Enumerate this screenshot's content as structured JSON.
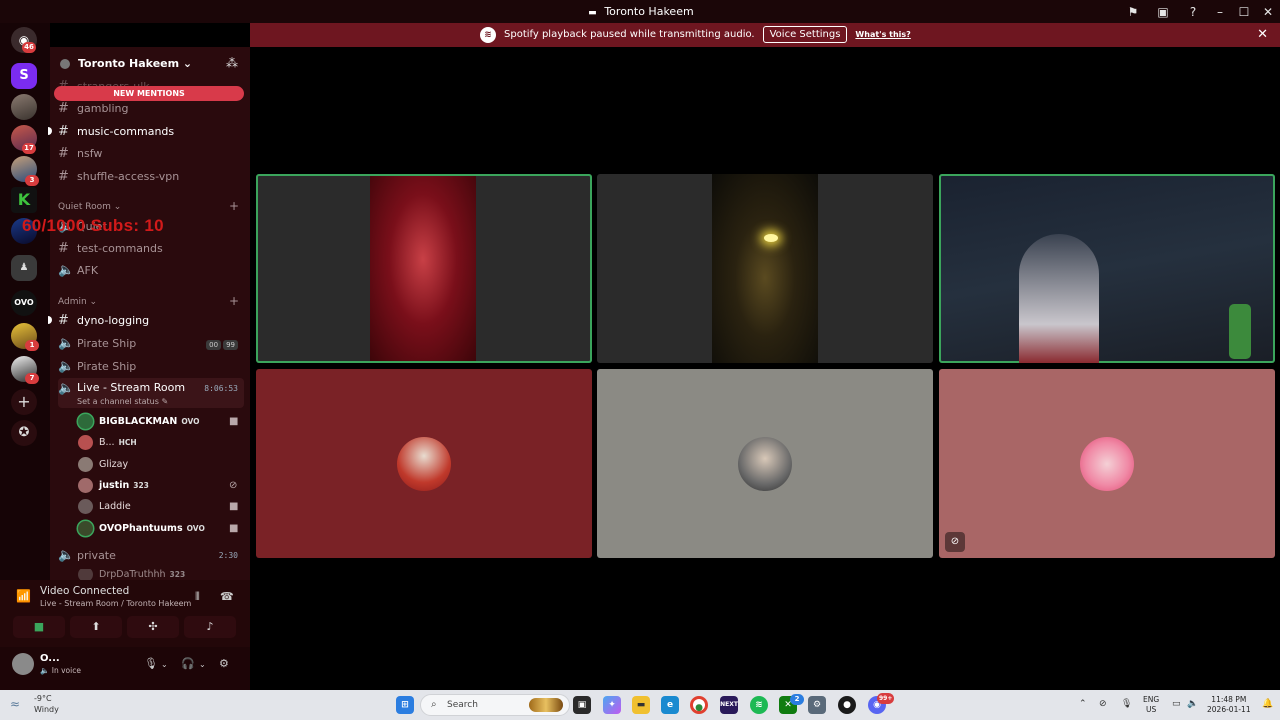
{
  "window": {
    "title": "Toronto Hakeem"
  },
  "notice": {
    "message": "Spotify playback paused while transmitting audio.",
    "button": "Voice Settings",
    "link": "What's this?"
  },
  "server": {
    "name": "Toronto Hakeem",
    "new_mentions": "NEW MENTIONS"
  },
  "rail_badges": {
    "home": "46",
    "s4": "17",
    "s5": "3",
    "s9": "1",
    "s10": "7"
  },
  "overlay_text": "60/1000  Subs: 10",
  "channels_top": [
    {
      "label": "strangers-ulk"
    },
    {
      "label": "gambling"
    },
    {
      "label": "music-commands"
    },
    {
      "label": "nsfw"
    },
    {
      "label": "shuffle-access-vpn"
    }
  ],
  "category_quiet": "Quiet Room",
  "channels_quiet": [
    {
      "label": "Quiet"
    },
    {
      "label": "test-commands"
    },
    {
      "label": "AFK"
    }
  ],
  "category_admin": "Admin",
  "channels_admin": [
    {
      "label": "dyno-logging"
    },
    {
      "label": "Pirate Ship",
      "tag1": "00",
      "tag2": "99"
    },
    {
      "label": "Pirate Ship"
    },
    {
      "label": "Live - Stream Room",
      "timer": "8:06:53"
    }
  ],
  "channel_status": "Set a channel status",
  "members": [
    {
      "name": "BIGBLACKMAN",
      "tag": "OVO"
    },
    {
      "name": "B...",
      "tag": "HCH"
    },
    {
      "name": "Glizay",
      "tag": ""
    },
    {
      "name": "justin",
      "tag": "323"
    },
    {
      "name": "Laddie",
      "tag": ""
    },
    {
      "name": "OVOPhantuums",
      "tag": "OVO"
    }
  ],
  "private_channel": {
    "label": "private",
    "timer": "2:30"
  },
  "private_member": {
    "name": "DrpDaTruthhh",
    "tag": "323"
  },
  "voice": {
    "status": "Video Connected",
    "location": "Live - Stream Room / Toronto Hakeem"
  },
  "user": {
    "name": "O...",
    "status": "In voice"
  },
  "taskbar": {
    "temp": "-9°C",
    "condition": "Windy",
    "search": "Search",
    "lang_top": "ENG",
    "lang_bottom": "US",
    "time": "11:48 PM",
    "date": "2026-01-11",
    "chat_badge": "2",
    "discord_badge": "99+"
  },
  "colors": {
    "accent_red": "#6e1620",
    "speaking_green": "#3ba55c",
    "tile_red": "#7a2226",
    "tile_grey": "#8b8a84",
    "tile_pink": "#a96666"
  }
}
